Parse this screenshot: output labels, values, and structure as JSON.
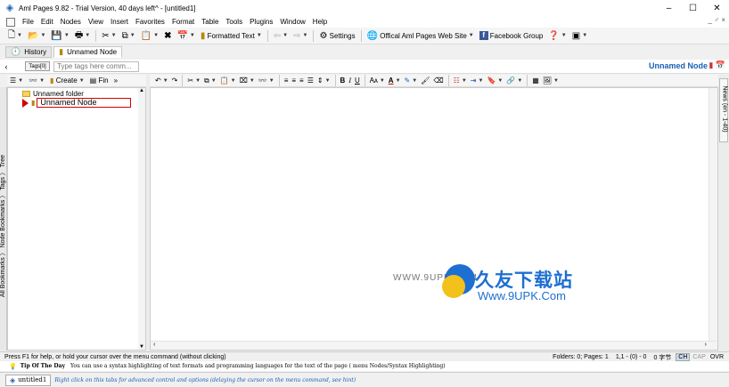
{
  "window": {
    "title": "Aml Pages 9.82 - Trial Version, 40 days left^ - [untitled1]",
    "app_icon": "aml-pages-logo-icon",
    "buttons": [
      "–",
      "☐",
      "✕"
    ]
  },
  "menu": {
    "items": [
      "File",
      "Edit",
      "Nodes",
      "View",
      "Insert",
      "Favorites",
      "Format",
      "Table",
      "Tools",
      "Plugins",
      "Window",
      "Help"
    ],
    "mdi_controls": "_ ♂ ×"
  },
  "toolbar": {
    "formatted_text": "Formatted Text",
    "settings": "Settings",
    "official_site": "Offical Aml Pages Web Site",
    "facebook_group": "Facebook Group"
  },
  "tabs": [
    {
      "label": "History"
    },
    {
      "label": "Unnamed Node"
    }
  ],
  "tags": {
    "button": "Tags[0]",
    "placeholder": "Type tags here comm..."
  },
  "node_title": "Unnamed Node",
  "tree_toolbar": {
    "create": "Create",
    "find": "Fin"
  },
  "tree": {
    "folder": "Unnamed folder",
    "node": "Unnamed Node"
  },
  "left_vtabs": "All Bookmarks  〉 Node Bookmarks  〉 Tags  〉 Tree",
  "right_vtab": "News (en - 1-40)",
  "watermark": {
    "url1": "WWW.9UPK.COM",
    "cn": "久友下载站",
    "url2": "Www.9UPK.Com"
  },
  "status": {
    "help": "Press F1 for help, or hold your cursor over the menu command (without clicking)",
    "folders_pages": "Folders: 0; Pages: 1",
    "position": "1,1 - (0) - 0",
    "encoding": "0 字节",
    "indicators": [
      {
        "label": "CH",
        "on": true
      },
      {
        "label": "CAP",
        "on": false
      },
      {
        "label": "OVR",
        "on": false
      }
    ]
  },
  "tip": {
    "title": "Tip Of The Day",
    "text": "You can use a syntax highlighting of text formats and programming languages for the text of the page ( menu Nodes/Syntax Highlighting)"
  },
  "doc": {
    "tab": "untitled1",
    "hint": "Right click on this tabs for advanced control and options (delaying the cursor on the menu command, see hint)"
  }
}
